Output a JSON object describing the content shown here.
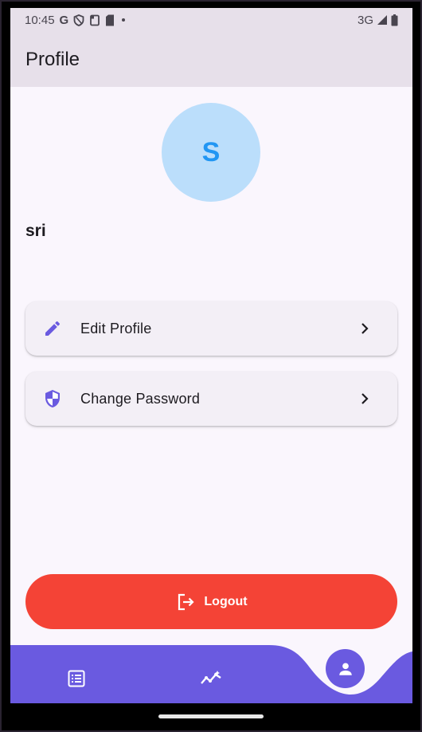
{
  "status_bar": {
    "time": "10:45",
    "google_glyph": "G",
    "network": "3G",
    "icons": [
      "google-icon",
      "shield-icon",
      "screenshot-icon",
      "sim-icon",
      "dot-icon",
      "signal-icon",
      "battery-icon"
    ]
  },
  "app_bar": {
    "title": "Profile"
  },
  "profile": {
    "avatar_letter": "S",
    "name": "sri"
  },
  "menu": {
    "items": [
      {
        "label": "Edit Profile",
        "icon": "pencil-icon"
      },
      {
        "label": "Change Password",
        "icon": "shield-icon"
      }
    ]
  },
  "logout": {
    "label": "Logout",
    "icon": "logout-icon"
  },
  "bottom_nav": {
    "items": [
      {
        "icon": "list-icon"
      },
      {
        "icon": "insights-icon"
      },
      {
        "icon": "person-icon",
        "selected": true
      }
    ]
  },
  "colors": {
    "primary": "#6a5ae0",
    "app_bar": "#e7e0ea",
    "background": "#faf6fd",
    "logout": "#f44336",
    "avatar_bg": "#bbdefb",
    "avatar_text": "#2196f3"
  }
}
